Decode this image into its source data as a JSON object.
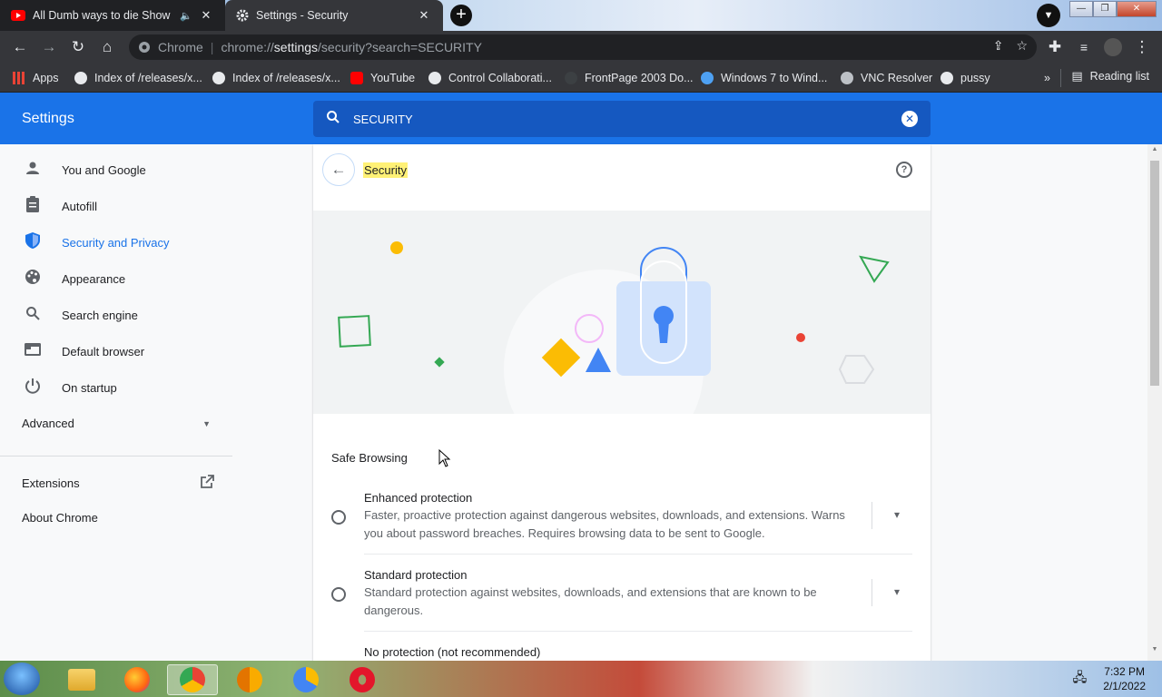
{
  "tabs": [
    {
      "title": "All Dumb ways to die Show",
      "icon": "youtube-icon"
    },
    {
      "title": "Settings - Security",
      "icon": "gear-icon"
    }
  ],
  "toolbar": {
    "site_label": "Chrome",
    "url_pre": "chrome://",
    "url_main": "settings",
    "url_post": "/security?search=SECURITY"
  },
  "bookmarks": {
    "items": [
      {
        "label": "Apps"
      },
      {
        "label": "Index of /releases/x..."
      },
      {
        "label": "Index of /releases/x..."
      },
      {
        "label": "YouTube"
      },
      {
        "label": "Control Collaborati..."
      },
      {
        "label": "FrontPage 2003 Do..."
      },
      {
        "label": "Windows 7 to Wind..."
      },
      {
        "label": "VNC Resolver"
      },
      {
        "label": "pussy"
      }
    ],
    "overflow": "»",
    "reading_list": "Reading list"
  },
  "settings": {
    "title": "Settings",
    "search_value": "SECURITY"
  },
  "sidebar": {
    "items": [
      {
        "label": "You and Google",
        "icon": "person-icon"
      },
      {
        "label": "Autofill",
        "icon": "clipboard-icon"
      },
      {
        "label": "Security and Privacy",
        "icon": "shield-icon"
      },
      {
        "label": "Appearance",
        "icon": "palette-icon"
      },
      {
        "label": "Search engine",
        "icon": "search-icon"
      },
      {
        "label": "Default browser",
        "icon": "browser-icon"
      },
      {
        "label": "On startup",
        "icon": "power-icon"
      }
    ],
    "advanced": "Advanced",
    "extensions": "Extensions",
    "about": "About Chrome"
  },
  "page": {
    "title": "Security",
    "section": "Safe Browsing",
    "options": [
      {
        "title": "Enhanced protection",
        "desc": "Faster, proactive protection against dangerous websites, downloads, and extensions. Warns you about password breaches. Requires browsing data to be sent to Google."
      },
      {
        "title": "Standard protection",
        "desc": "Standard protection against websites, downloads, and extensions that are known to be dangerous."
      },
      {
        "title": "No protection (not recommended)",
        "desc": ""
      }
    ]
  },
  "taskbar": {
    "time": "7:32 PM",
    "date": "2/1/2022"
  },
  "colors": {
    "accent": "#1a73e8",
    "highlight": "#fff176"
  }
}
